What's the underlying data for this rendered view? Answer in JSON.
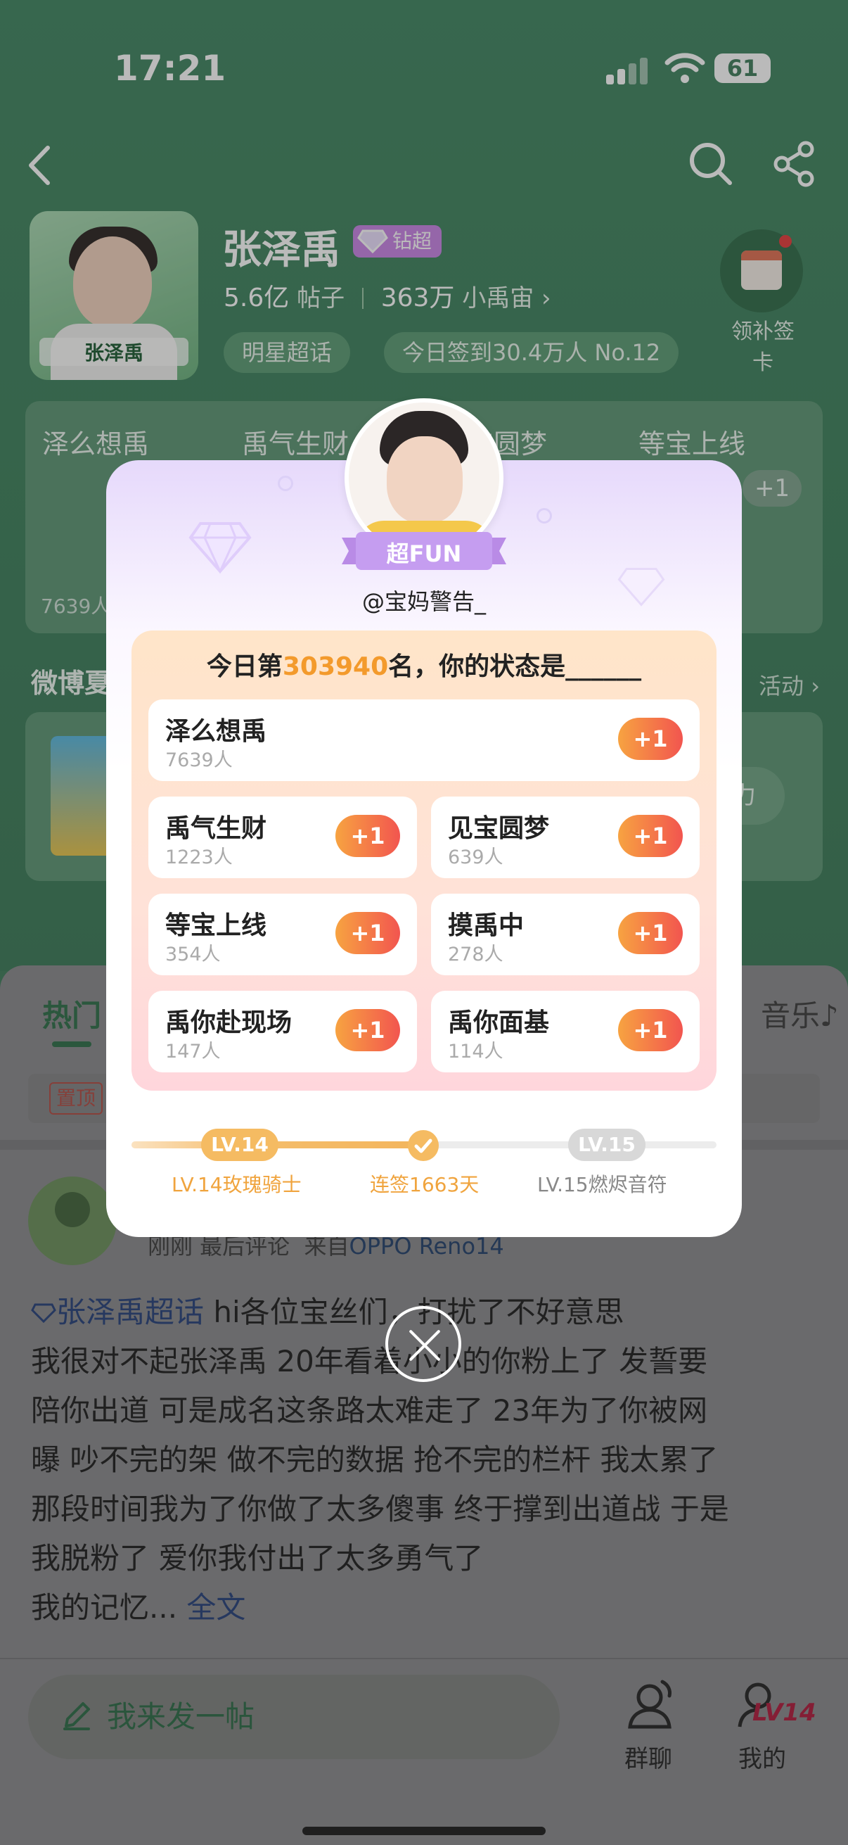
{
  "status_bar": {
    "time": "17:21",
    "battery": "61"
  },
  "header": {
    "topic_name": "张泽禹",
    "badge": "钻超",
    "avatar_caption": "张泽禹",
    "posts_count": "5.6亿",
    "posts_label": "帖子",
    "fans_count": "363万",
    "fans_label": "小禹宙",
    "chevron": "›",
    "pill_category": "明星超话",
    "pill_checkin": "今日签到30.4万人 No.12",
    "checkin_card_label": "领补签卡"
  },
  "hot_row": {
    "labels": [
      "泽么想禹",
      "禹气生财",
      "见宝圆梦",
      "等宝上线"
    ],
    "count": "7639人",
    "plus": "+1"
  },
  "section": {
    "title": "微博夏",
    "more": "活动 ›"
  },
  "feed": {
    "tab_hot": "热门",
    "tab_music": "音乐♪",
    "pin": "置顶",
    "post_meta_time": "刚刚 最后评论",
    "post_meta_source_prefix": "来自",
    "post_meta_device": "OPPO Reno14",
    "post_topic": "张泽禹超话",
    "post_lines": [
      " hi各位宝丝们，打扰了不好意思",
      "  我很对不起张泽禹 20年看着小小的你粉上了 发誓要",
      "陪你出道 可是成名这条路太难走了 23年为了你被网",
      "曝 吵不完的架 做不完的数据 抢不完的栏杆 我太累了",
      "那段时间我为了你做了太多傻事 终于撑到出道战 于是",
      "我脱粉了 爱你我付出了太多勇气了",
      "  我的记忆... "
    ],
    "post_more": "全文",
    "compose_placeholder": "我来发一帖",
    "group_chat": "群聊",
    "mine": "我的",
    "mine_level": "LV14"
  },
  "modal": {
    "fun_badge": "超FUN",
    "username": "@宝妈警告_",
    "status_prefix": "今日第",
    "rank": "303940",
    "status_suffix": "名，你的状态是______",
    "options": [
      {
        "title": "泽么想禹",
        "count": "7639人",
        "action": "+1"
      },
      {
        "title": "禹气生财",
        "count": "1223人",
        "action": "+1"
      },
      {
        "title": "见宝圆梦",
        "count": "639人",
        "action": "+1"
      },
      {
        "title": "等宝上线",
        "count": "354人",
        "action": "+1"
      },
      {
        "title": "摸禹中",
        "count": "278人",
        "action": "+1"
      },
      {
        "title": "禹你赴现场",
        "count": "147人",
        "action": "+1"
      },
      {
        "title": "禹你面基",
        "count": "114人",
        "action": "+1"
      }
    ],
    "level_current": "LV.14",
    "level_next": "LV.15",
    "level_current_name": "LV.14玫瑰骑士",
    "level_next_name": "LV.15燃烬音符",
    "streak": "连签1663天"
  },
  "icons": {
    "back": "chevron-left-icon",
    "search": "search-icon",
    "share": "share-icon",
    "close": "close-icon",
    "compose": "pencil-icon"
  },
  "colors": {
    "brand_green": "#3e7d5a",
    "rank_orange": "#f39a2c",
    "plus_gradient_start": "#f7a341",
    "plus_gradient_end": "#f2554f",
    "level_gold": "#f5bb62"
  }
}
